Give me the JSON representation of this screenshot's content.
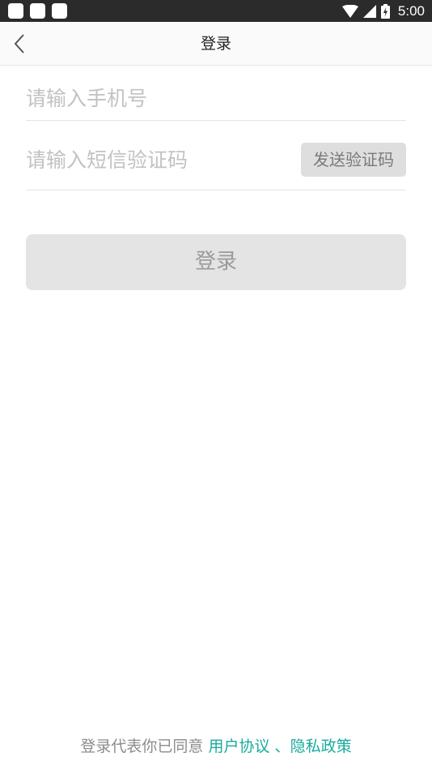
{
  "status_bar": {
    "time": "5:00",
    "icons": [
      "notification-icon",
      "notification-icon",
      "notification-icon",
      "wifi-icon",
      "signal-icon",
      "battery-icon"
    ]
  },
  "nav": {
    "title": "登录",
    "back_icon": "chevron-left-icon"
  },
  "form": {
    "phone_placeholder": "请输入手机号",
    "phone_value": "",
    "sms_placeholder": "请输入短信验证码",
    "sms_value": "",
    "send_code_label": "发送验证码",
    "login_label": "登录"
  },
  "footer": {
    "prefix": "登录代表你已同意",
    "user_agreement": "用户协议",
    "separator": "、",
    "privacy_policy": "隐私政策"
  },
  "colors": {
    "status_bar_bg": "#2b2b2b",
    "link": "#1aab9c",
    "disabled_button_bg": "#e4e4e4"
  }
}
